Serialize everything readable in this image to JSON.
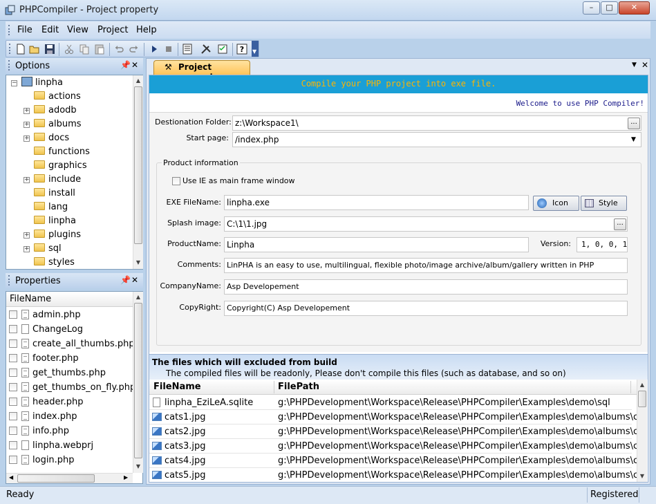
{
  "window": {
    "title": "PHPCompiler - Project property",
    "minimize": "–",
    "maximize": "□",
    "close": "✕"
  },
  "menu": [
    "File",
    "Edit",
    "View",
    "Project",
    "Help"
  ],
  "toolbar_icons": [
    "new-icon",
    "open-icon",
    "save-icon",
    "cut-icon",
    "copy-icon",
    "paste-icon",
    "undo-icon",
    "redo-icon",
    "run-icon",
    "stop-icon",
    "properties-icon",
    "build-icon",
    "checklist-icon",
    "help-icon"
  ],
  "options_panel": {
    "title": "Options",
    "root": "linpha",
    "items": [
      {
        "label": "actions",
        "expandable": false
      },
      {
        "label": "adodb",
        "expandable": true
      },
      {
        "label": "albums",
        "expandable": true
      },
      {
        "label": "docs",
        "expandable": true
      },
      {
        "label": "functions",
        "expandable": false
      },
      {
        "label": "graphics",
        "expandable": false
      },
      {
        "label": "include",
        "expandable": true
      },
      {
        "label": "install",
        "expandable": false
      },
      {
        "label": "lang",
        "expandable": false
      },
      {
        "label": "linpha",
        "expandable": false
      },
      {
        "label": "plugins",
        "expandable": true
      },
      {
        "label": "sql",
        "expandable": true
      },
      {
        "label": "styles",
        "expandable": false
      }
    ]
  },
  "properties_panel": {
    "title": "Properties",
    "column": "FileName",
    "files": [
      {
        "name": "admin.php",
        "type": "txt"
      },
      {
        "name": "ChangeLog",
        "type": "blank"
      },
      {
        "name": "create_all_thumbs.php",
        "type": "txt"
      },
      {
        "name": "footer.php",
        "type": "txt"
      },
      {
        "name": "get_thumbs.php",
        "type": "txt"
      },
      {
        "name": "get_thumbs_on_fly.php",
        "type": "txt"
      },
      {
        "name": "header.php",
        "type": "txt"
      },
      {
        "name": "index.php",
        "type": "txt"
      },
      {
        "name": "info.php",
        "type": "txt"
      },
      {
        "name": "linpha.webprj",
        "type": "blank"
      },
      {
        "name": "login.php",
        "type": "txt"
      }
    ]
  },
  "tab": {
    "label": "Project property"
  },
  "banner": {
    "text": "Compile your PHP project into exe file.",
    "welcome": "Welcome to use PHP Compiler!"
  },
  "form": {
    "destination_label": "Destionation Folder:",
    "destination_value": "z:\\Workspace1\\",
    "start_label": "Start page:",
    "start_value": "/index.php",
    "group_label": "Product information",
    "use_ie_label": "Use IE as main frame window",
    "use_ie_checked": false,
    "exe_label": "EXE FileName:",
    "exe_value": "linpha.exe",
    "icon_button": "Icon",
    "style_button": "Style",
    "splash_label": "Splash image:",
    "splash_value": "C:\\1\\1.jpg",
    "product_label": "ProductName:",
    "product_value": "Linpha",
    "version_label": "Version:",
    "version_value": "1, 0, 0, 1",
    "comments_label": "Comments:",
    "comments_value": "LinPHA is an easy to use, multilingual, flexible photo/image archive/album/gallery written in PHP",
    "company_label": "CompanyName:",
    "company_value": "Asp Developement",
    "copyright_label": "CopyRight:",
    "copyright_value": "Copyright(C) Asp Developement",
    "browse": "..."
  },
  "excluded": {
    "title": "The files which will excluded from build",
    "subtitle": "The compiled files will be readonly, Please don't compile this files (such as database, and so on)",
    "col_file": "FileName",
    "col_path": "FilePath",
    "rows": [
      {
        "file": "linpha_EziLeA.sqlite",
        "path": "g:\\PHPDevelopment\\Workspace\\Release\\PHPCompiler\\Examples\\demo\\sql",
        "type": "blank"
      },
      {
        "file": "cats1.jpg",
        "path": "g:\\PHPDevelopment\\Workspace\\Release\\PHPCompiler\\Examples\\demo\\albums\\cats",
        "type": "img"
      },
      {
        "file": "cats2.jpg",
        "path": "g:\\PHPDevelopment\\Workspace\\Release\\PHPCompiler\\Examples\\demo\\albums\\cats",
        "type": "img"
      },
      {
        "file": "cats3.jpg",
        "path": "g:\\PHPDevelopment\\Workspace\\Release\\PHPCompiler\\Examples\\demo\\albums\\cats",
        "type": "img"
      },
      {
        "file": "cats4.jpg",
        "path": "g:\\PHPDevelopment\\Workspace\\Release\\PHPCompiler\\Examples\\demo\\albums\\cats",
        "type": "img"
      },
      {
        "file": "cats5.jpg",
        "path": "g:\\PHPDevelopment\\Workspace\\Release\\PHPCompiler\\Examples\\demo\\albums\\cats",
        "type": "img"
      }
    ]
  },
  "status": {
    "left": "Ready",
    "right": "Registered"
  },
  "colors": {
    "banner_bg": "#1a9fd6",
    "banner_text": "#ffb400",
    "welcome_text": "#1a1a8a",
    "tab_bg": "#ffd070"
  }
}
